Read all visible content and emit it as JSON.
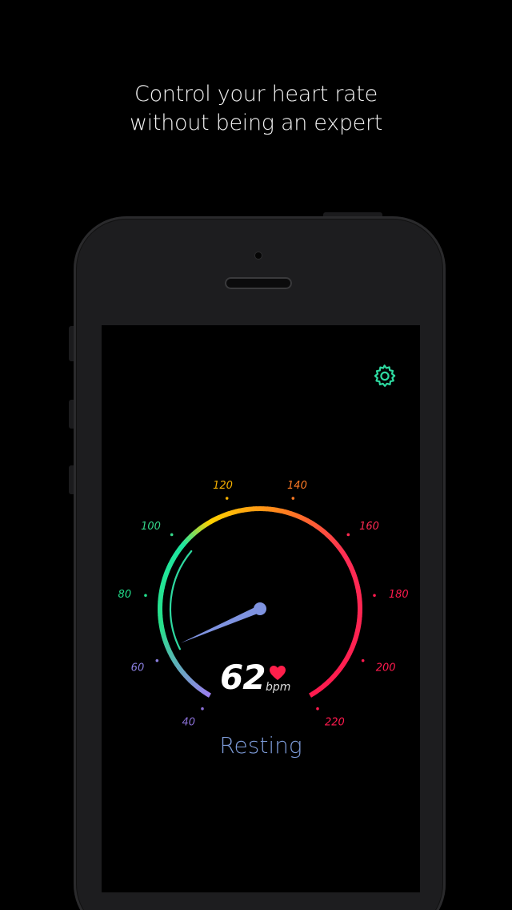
{
  "headline": {
    "line1": "Control your heart rate",
    "line2": "without being an expert"
  },
  "app": {
    "settings_icon": "gear-icon",
    "accent_color": "#2ed9a0",
    "reading": {
      "value": "62",
      "unit": "bpm",
      "heart_icon": "heart-icon",
      "heart_color": "#ff1f4b",
      "zone": "Resting",
      "zone_color": "#7d9bd8"
    },
    "gauge": {
      "min": 40,
      "max": 220,
      "current": 62,
      "inner_arc_from": 60,
      "inner_arc_to": 100,
      "needle_color": "#7f93e0",
      "ticks": [
        {
          "label": "40",
          "value": 40,
          "color": "#8a6fd6"
        },
        {
          "label": "60",
          "value": 60,
          "color": "#8a7fe0"
        },
        {
          "label": "80",
          "value": 80,
          "color": "#22e08c"
        },
        {
          "label": "100",
          "value": 100,
          "color": "#35d88a"
        },
        {
          "label": "120",
          "value": 120,
          "color": "#f5b000"
        },
        {
          "label": "140",
          "value": 140,
          "color": "#ff7a24"
        },
        {
          "label": "160",
          "value": 160,
          "color": "#ff2a52"
        },
        {
          "label": "180",
          "value": 180,
          "color": "#ff1a4e"
        },
        {
          "label": "200",
          "value": 200,
          "color": "#ff1a4e"
        },
        {
          "label": "220",
          "value": 220,
          "color": "#ff1a4e"
        }
      ],
      "gradient_stops": [
        {
          "value": 40,
          "color": "#9c7cf0"
        },
        {
          "value": 70,
          "color": "#28e08a"
        },
        {
          "value": 100,
          "color": "#1ee6a0"
        },
        {
          "value": 112,
          "color": "#ffd200"
        },
        {
          "value": 140,
          "color": "#ff7a22"
        },
        {
          "value": 165,
          "color": "#ff2d55"
        },
        {
          "value": 220,
          "color": "#ff1a4e"
        }
      ]
    }
  }
}
